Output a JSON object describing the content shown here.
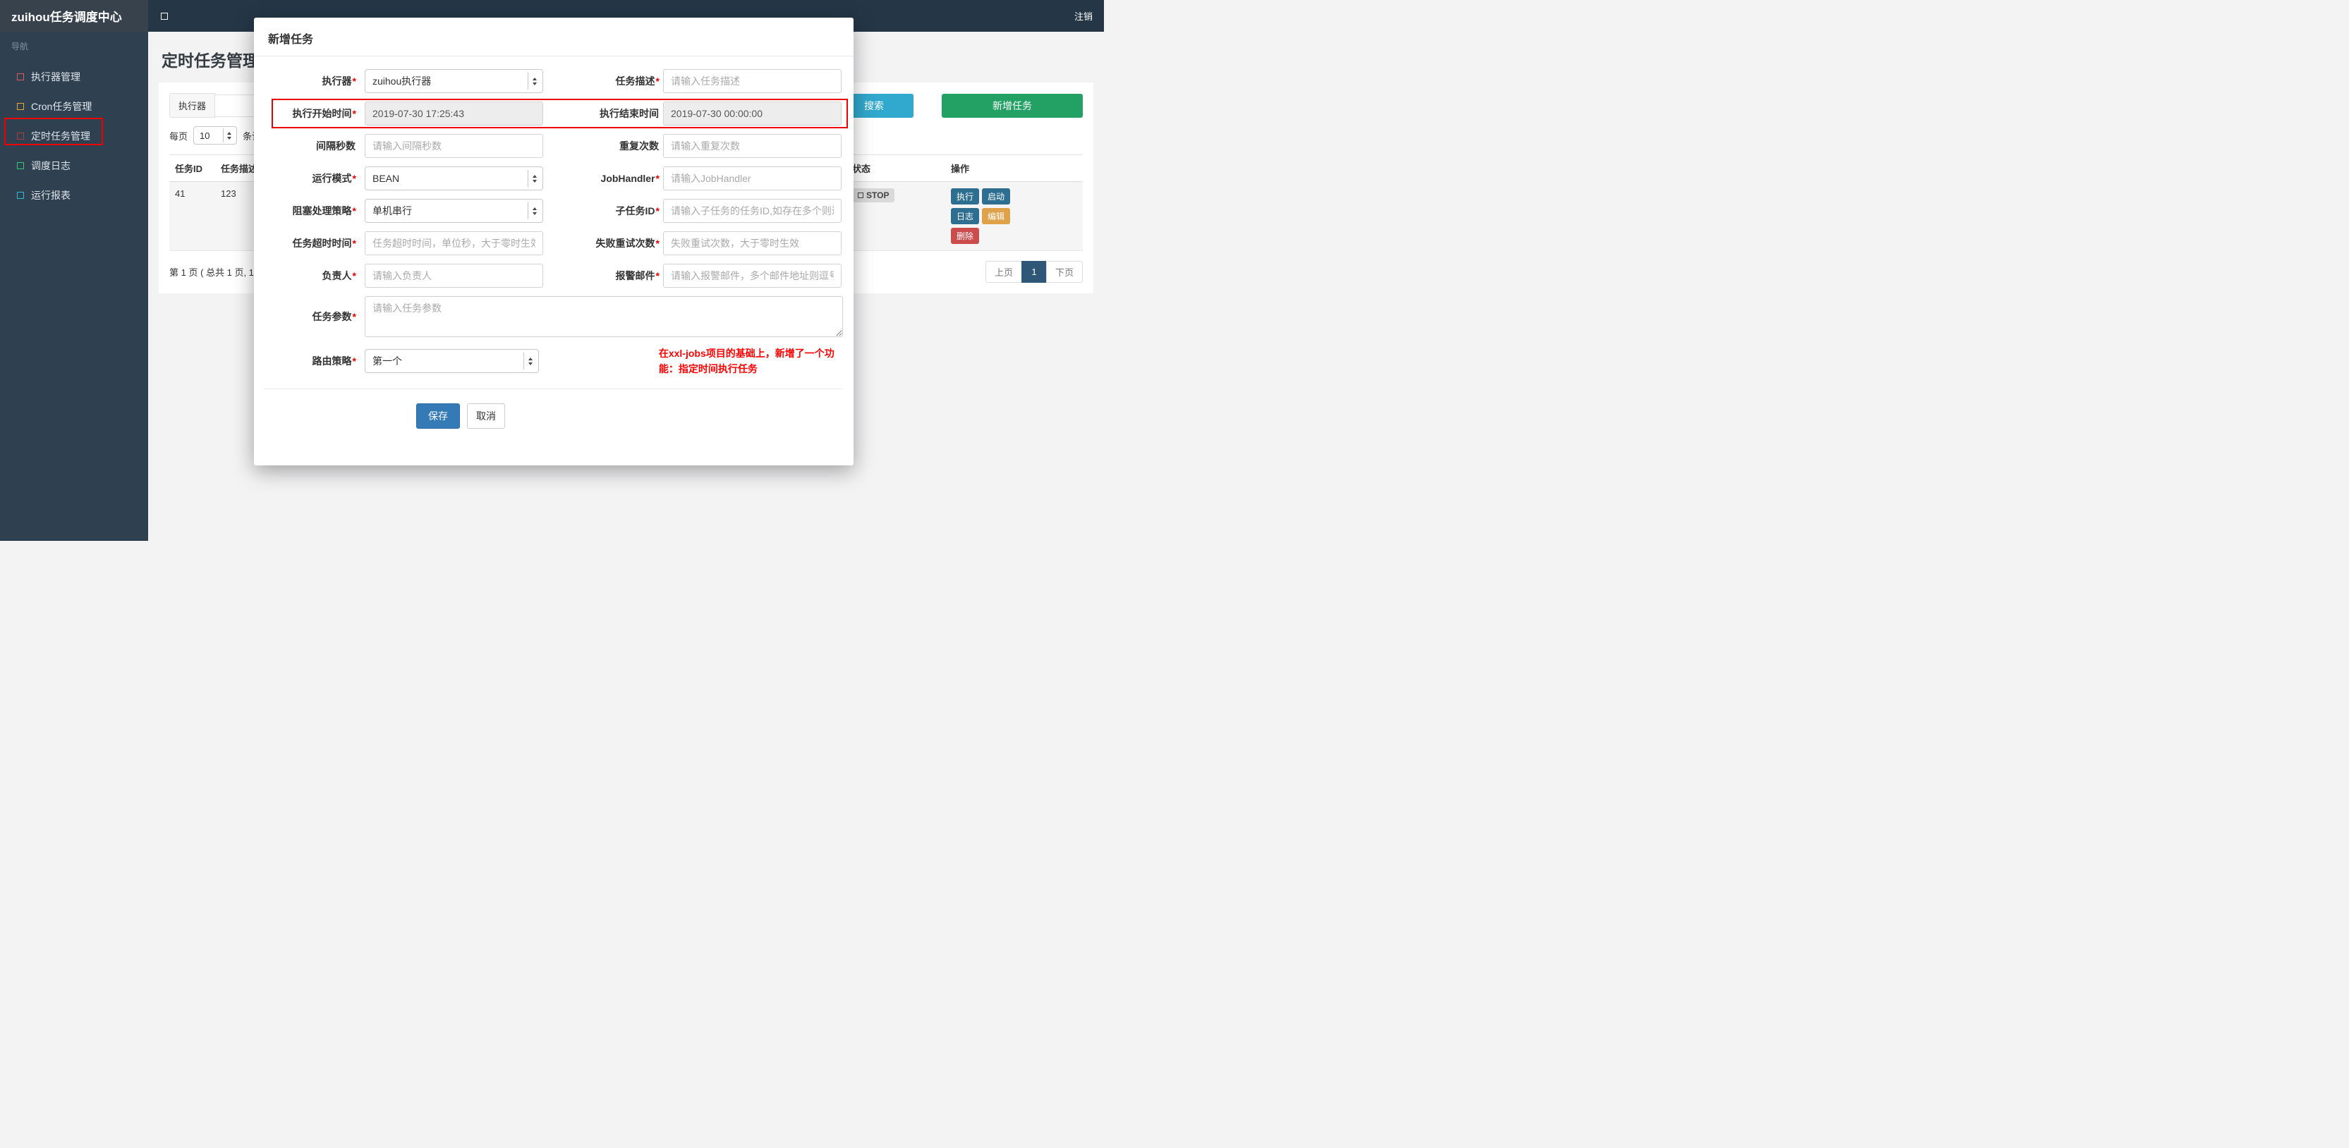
{
  "navbar": {
    "brand": "zuihou任务调度中心",
    "logout": "注销"
  },
  "sidebar": {
    "section_label": "导航",
    "items": [
      {
        "label": "执行器管理",
        "icon_color": "#e05c5c"
      },
      {
        "label": "Cron任务管理",
        "icon_color": "#f0a532"
      },
      {
        "label": "定时任务管理",
        "icon_color": "#b23c3c"
      },
      {
        "label": "调度日志",
        "icon_color": "#2ecc71"
      },
      {
        "label": "运行报表",
        "icon_color": "#35b8e0"
      }
    ]
  },
  "page": {
    "title": "定时任务管理"
  },
  "toolbar": {
    "executor_addon": "执行器",
    "search_label": "搜索",
    "add_task_label": "新增任务",
    "perpage_prefix": "每页",
    "perpage_value": "10",
    "perpage_suffix": "条记录"
  },
  "table": {
    "headers": {
      "job_id": "任务ID",
      "job_desc": "任务描述",
      "status": "状态",
      "actions": "操作"
    },
    "row": {
      "job_id": "41",
      "job_desc": "123",
      "status": "STOP",
      "btn_execute": "执行",
      "btn_start": "启动",
      "btn_log": "日志",
      "btn_edit": "编辑",
      "btn_delete": "删除"
    }
  },
  "pagination": {
    "summary": "第 1 页 ( 总共 1 页, 1",
    "prev": "上页",
    "current": "1",
    "next": "下页"
  },
  "modal": {
    "title": "新增任务",
    "fields": {
      "executor": {
        "label": "执行器",
        "star": "*",
        "value": "zuihou执行器"
      },
      "job_desc": {
        "label": "任务描述",
        "star": "*",
        "placeholder": "请输入任务描述"
      },
      "start_time": {
        "label": "执行开始时间",
        "star": "*",
        "value": "2019-07-30 17:25:43"
      },
      "end_time": {
        "label": "执行结束时间",
        "star": "",
        "value": "2019-07-30 00:00:00"
      },
      "interval": {
        "label": "间隔秒数",
        "star": "",
        "placeholder": "请输入间隔秒数"
      },
      "repeat_count": {
        "label": "重复次数",
        "star": "",
        "placeholder": "请输入重复次数"
      },
      "run_mode": {
        "label": "运行模式",
        "star": "*",
        "value": "BEAN"
      },
      "job_handler": {
        "label": "JobHandler",
        "star": "*",
        "placeholder": "请输入JobHandler"
      },
      "block_strategy": {
        "label": "阻塞处理策略",
        "star": "*",
        "value": "单机串行"
      },
      "child_job_id": {
        "label": "子任务ID",
        "star": "*",
        "placeholder": "请输入子任务的任务ID,如存在多个则逗号分隔"
      },
      "timeout": {
        "label": "任务超时时间",
        "star": "*",
        "placeholder": "任务超时时间，单位秒，大于零时生效"
      },
      "fail_retry": {
        "label": "失败重试次数",
        "star": "*",
        "placeholder": "失败重试次数，大于零时生效"
      },
      "owner": {
        "label": "负责人",
        "star": "*",
        "placeholder": "请输入负责人"
      },
      "alarm_email": {
        "label": "报警邮件",
        "star": "*",
        "placeholder": "请输入报警邮件，多个邮件地址则逗号分隔"
      },
      "job_param": {
        "label": "任务参数",
        "star": "*",
        "placeholder": "请输入任务参数"
      },
      "route_strategy": {
        "label": "路由策略",
        "star": "*",
        "value": "第一个"
      }
    },
    "note": "在xxl-jobs项目的基础上，新增了一个功能：指定时间执行任务",
    "save_label": "保存",
    "cancel_label": "取消"
  },
  "colors": {
    "navbar": "#253646",
    "sidebar": "#2f4050",
    "search_button": "#31a8cd",
    "add_button": "#23a164",
    "primary_button": "#337ab7",
    "warning_button": "#dfa149",
    "danger_button": "#cc4b4c",
    "annotation": "#ee0000"
  }
}
